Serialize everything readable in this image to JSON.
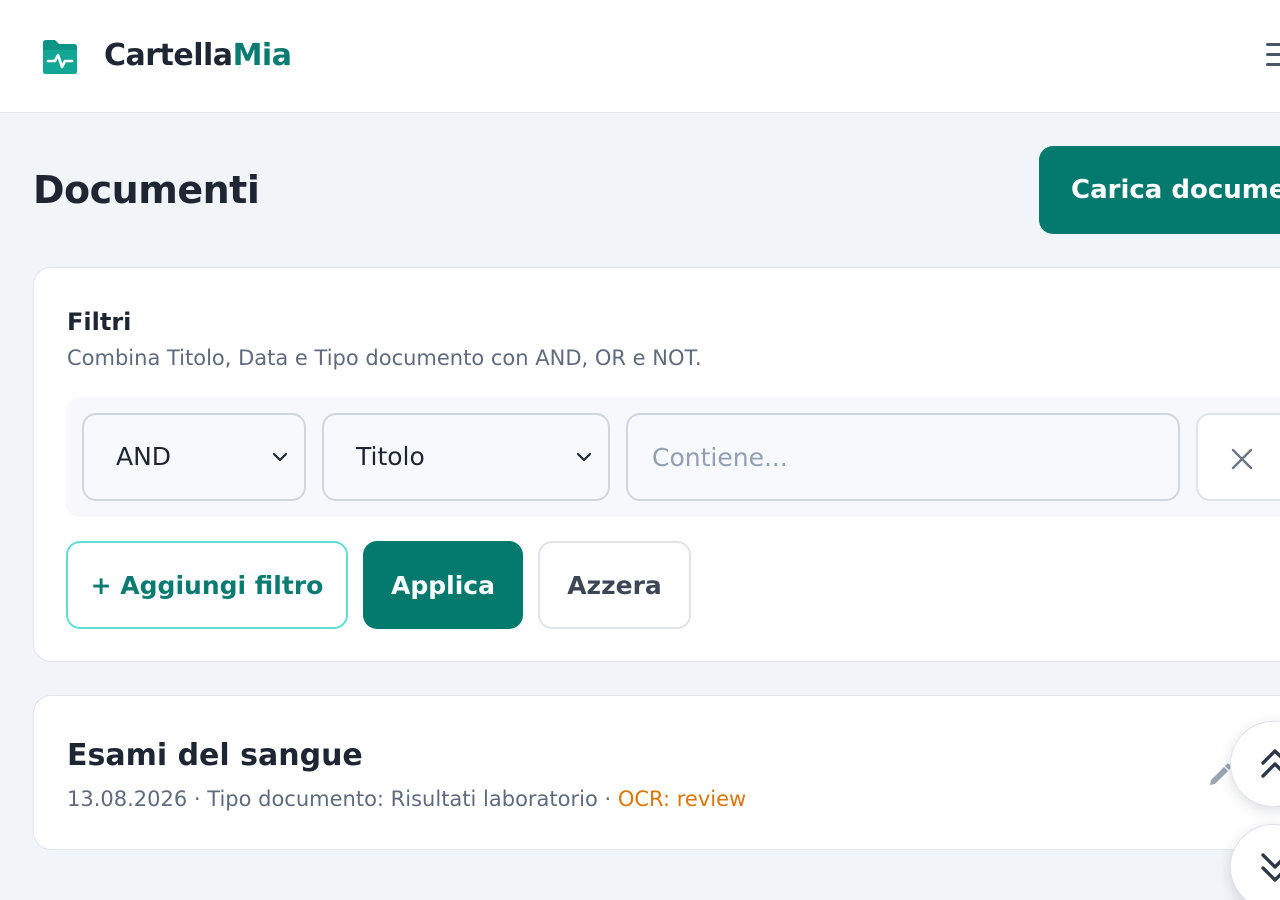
{
  "header": {
    "brand_part1": "Cartella",
    "brand_part2": "Mia",
    "logo_icon": "folder-pulse-icon",
    "menu_icon": "hamburger-menu-icon"
  },
  "page": {
    "title": "Documenti",
    "upload_label": "Carica documento"
  },
  "filters": {
    "title": "Filtri",
    "subtitle": "Combina Titolo, Data e Tipo documento con AND, OR e NOT.",
    "rows": [
      {
        "operator": "AND",
        "field": "Titolo",
        "value": "",
        "placeholder": "Contiene..."
      }
    ],
    "add_label": "+ Aggiungi filtro",
    "apply_label": "Applica",
    "reset_label": "Azzera"
  },
  "documents": [
    {
      "title": "Esami del sangue",
      "meta": "13.08.2026 · Tipo documento: Risultati laboratorio · ",
      "ocr": "OCR: review"
    }
  ],
  "colors": {
    "accent": "#037a6d",
    "accent_text": "#0a7b70",
    "ocr_status": "#d97706",
    "background": "#f1f4f8"
  }
}
